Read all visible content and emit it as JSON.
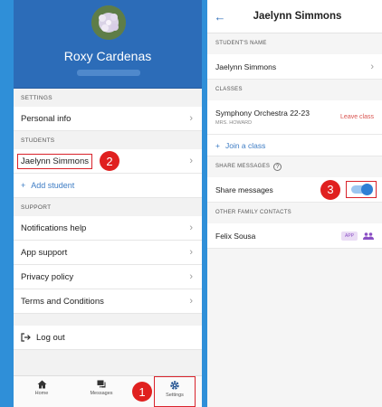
{
  "left": {
    "profile_name": "Roxy Cardenas",
    "sections": {
      "settings": "SETTINGS",
      "students": "STUDENTS",
      "support": "SUPPORT"
    },
    "settings_items": [
      "Personal info"
    ],
    "student_items": [
      "Jaelynn Simmons"
    ],
    "add_student": "Add student",
    "support_items": [
      "Notifications help",
      "App support",
      "Privacy policy",
      "Terms and Conditions"
    ],
    "logout": "Log out",
    "tabs": {
      "home": "Home",
      "messages": "Messages",
      "settings": "Settings"
    }
  },
  "badges": {
    "one": "1",
    "two": "2",
    "three": "3"
  },
  "right": {
    "title": "Jaelynn Simmons",
    "students_name_label": "STUDENT'S NAME",
    "student_name": "Jaelynn Simmons",
    "classes_label": "CLASSES",
    "class_name": "Symphony Orchestra 22-23",
    "teacher": "MRS. HOWARD",
    "leave_class": "Leave class",
    "join_class": "Join a class",
    "share_label": "SHARE MESSAGES",
    "share_row": "Share messages",
    "share_enabled": true,
    "other_contacts_label": "OTHER FAMILY CONTACTS",
    "contact_name": "Felix Sousa",
    "contact_badge": "APP"
  },
  "colors": {
    "background": "#2f8fd8",
    "header_blue": "#2c6cb8",
    "highlight_red": "#d9232b",
    "toggle_blue": "#2e7fd4"
  }
}
